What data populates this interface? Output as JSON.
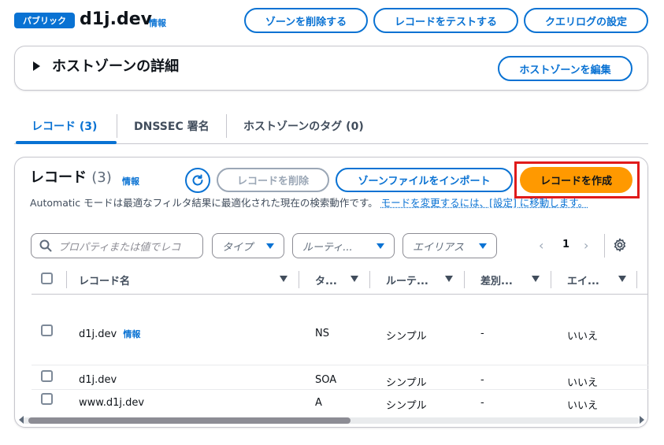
{
  "header": {
    "badge": "パブリック",
    "zone_name": "d1j.dev",
    "info": "情報",
    "buttons": {
      "delete_zone": "ゾーンを削除する",
      "test_record": "レコードをテストする",
      "query_log": "クエリログの設定"
    }
  },
  "details": {
    "title": "ホストゾーンの詳細",
    "edit_button": "ホストゾーンを編集"
  },
  "tabs": [
    {
      "label": "レコード (3)",
      "active": true
    },
    {
      "label": "DNSSEC 署名",
      "active": false
    },
    {
      "label": "ホストゾーンのタグ (0)",
      "active": false
    }
  ],
  "records": {
    "title": "レコード",
    "count": "(3)",
    "info": "情報",
    "delete_button": "レコードを削除",
    "import_button": "ゾーンファイルをインポート",
    "create_button": "レコードを作成",
    "description": "Automatic モードは最適なフィルタ結果に最適化された現在の検索動作です。",
    "description_link": "モードを変更するには、[設定] に移動します。",
    "search_placeholder": "プロパティまたは値でレコ",
    "filters": {
      "type": "タイプ",
      "routing": "ルーティ...",
      "alias": "エイリアス"
    },
    "page": "1",
    "columns": [
      "レコード名",
      "タ...",
      "ルーテ...",
      "差別...",
      "エイ..."
    ],
    "rows": [
      {
        "name": "d1j.dev",
        "type": "NS",
        "routing": "シンプル",
        "diff": "-",
        "alias": "いいえ"
      },
      {
        "name": "d1j.dev",
        "type": "SOA",
        "routing": "シンプル",
        "diff": "-",
        "alias": "いいえ"
      },
      {
        "name": "www.d1j.dev",
        "type": "A",
        "routing": "シンプル",
        "diff": "-",
        "alias": "いいえ"
      }
    ]
  },
  "colors": {
    "accent": "#0972d3",
    "primary_button": "#ff9900",
    "highlight": "#e01b1b"
  }
}
